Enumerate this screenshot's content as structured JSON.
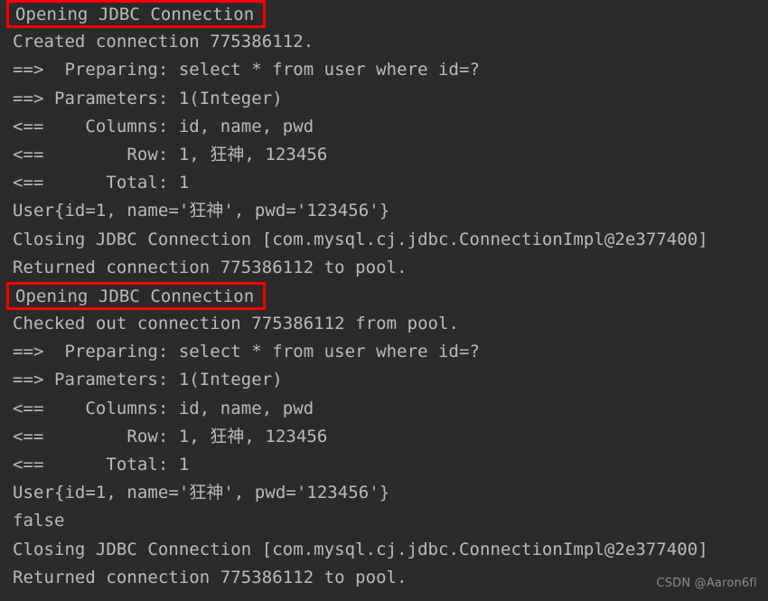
{
  "console": {
    "background_color": "#2b2b2b",
    "text_color": "#bbbbbb",
    "highlight_color": "#ff0000",
    "watermark": "CSDN @Aaron6fl",
    "lines": [
      {
        "text": "Opening JDBC Connection",
        "boxed": true
      },
      {
        "text": "Created connection 775386112.",
        "boxed": false
      },
      {
        "text": "==>  Preparing: select * from user where id=?",
        "boxed": false
      },
      {
        "text": "==> Parameters: 1(Integer)",
        "boxed": false
      },
      {
        "text": "<==    Columns: id, name, pwd",
        "boxed": false
      },
      {
        "text": "<==        Row: 1, 狂神, 123456",
        "boxed": false
      },
      {
        "text": "<==      Total: 1",
        "boxed": false
      },
      {
        "text": "User{id=1, name='狂神', pwd='123456'}",
        "boxed": false
      },
      {
        "text": "Closing JDBC Connection [com.mysql.cj.jdbc.ConnectionImpl@2e377400]",
        "boxed": false
      },
      {
        "text": "Returned connection 775386112 to pool.",
        "boxed": false
      },
      {
        "text": "Opening JDBC Connection",
        "boxed": true
      },
      {
        "text": "Checked out connection 775386112 from pool.",
        "boxed": false
      },
      {
        "text": "==>  Preparing: select * from user where id=?",
        "boxed": false
      },
      {
        "text": "==> Parameters: 1(Integer)",
        "boxed": false
      },
      {
        "text": "<==    Columns: id, name, pwd",
        "boxed": false
      },
      {
        "text": "<==        Row: 1, 狂神, 123456",
        "boxed": false
      },
      {
        "text": "<==      Total: 1",
        "boxed": false
      },
      {
        "text": "User{id=1, name='狂神', pwd='123456'}",
        "boxed": false
      },
      {
        "text": "false",
        "boxed": false
      },
      {
        "text": "Closing JDBC Connection [com.mysql.cj.jdbc.ConnectionImpl@2e377400]",
        "boxed": false
      },
      {
        "text": "Returned connection 775386112 to pool.",
        "boxed": false
      }
    ]
  }
}
